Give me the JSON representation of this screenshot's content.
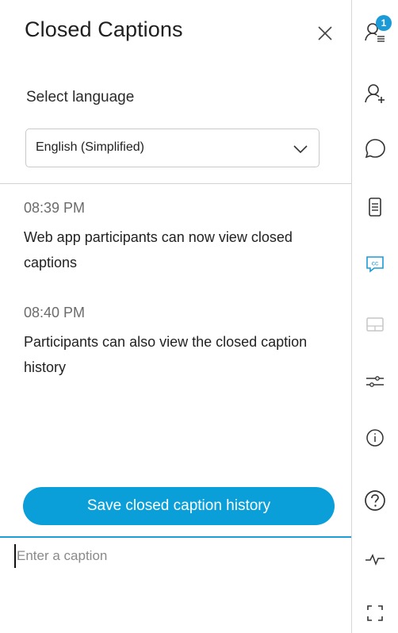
{
  "panel": {
    "title": "Closed Captions",
    "select_language_label": "Select language",
    "language_selected": "English (Simplified)",
    "save_button_label": "Save closed caption history",
    "caption_placeholder": "Enter a caption"
  },
  "captions": [
    {
      "time": "08:39 PM",
      "text": "Web app participants can now view closed captions"
    },
    {
      "time": "08:40 PM",
      "text": "Participants can also view the closed caption history"
    }
  ],
  "rail": {
    "participants_badge": "1",
    "icons": [
      "participants-icon",
      "add-participant-icon",
      "chat-icon",
      "notes-icon",
      "closed-captions-icon",
      "layout-icon",
      "settings-sliders-icon",
      "info-icon",
      "help-icon",
      "activity-icon",
      "fullscreen-icon"
    ]
  },
  "colors": {
    "accent": "#0a9fd8",
    "active_icon": "#1a9bd7",
    "disabled_icon": "#c5c5c5"
  }
}
